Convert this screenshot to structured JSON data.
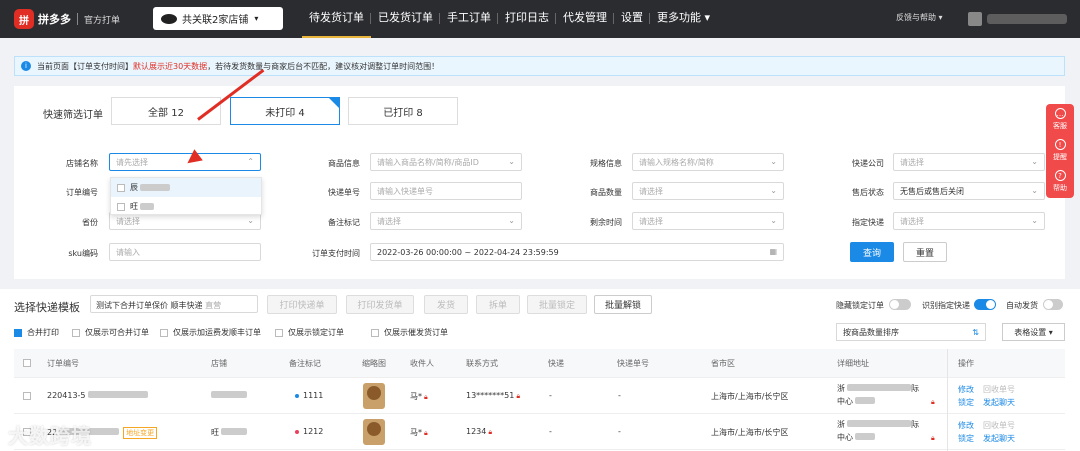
{
  "topbar": {
    "logo_badge": "拼",
    "logo_name": "拼多多",
    "logo_sub": "官方打单",
    "shop_select": "共关联2家店铺",
    "navs": [
      "待发货订单",
      "已发货订单",
      "手工订单",
      "打印日志",
      "代发管理",
      "设置",
      "更多功能 ▾"
    ],
    "feedback": "反馈与帮助 ▾"
  },
  "notice": {
    "icon": "info-icon",
    "prefix": "当前页面【订单支付时间】",
    "highlight": "默认展示近30天数据",
    "suffix": "，若待发货数量与商家后台不匹配，建议核对调整订单时间范围！"
  },
  "filter": {
    "quick_label": "快速筛选订单",
    "tabs": [
      {
        "label": "全部  12"
      },
      {
        "label": "未打印  4"
      },
      {
        "label": "已打印  8"
      }
    ],
    "fields": {
      "shop_name": {
        "label": "店铺名称",
        "placeholder": "请先选择"
      },
      "product_info": {
        "label": "商品信息",
        "placeholder": "请输入商品名称/简称/商品ID"
      },
      "spec_info": {
        "label": "规格信息",
        "placeholder": "请输入规格名称/简称"
      },
      "express_co": {
        "label": "快递公司",
        "placeholder": "请选择"
      },
      "order_no": {
        "label": "订单编号",
        "placeholder": ""
      },
      "tracking_no": {
        "label": "快递单号",
        "placeholder": "请输入快递单号"
      },
      "product_qty": {
        "label": "商品数量",
        "placeholder": "请选择"
      },
      "aftersale": {
        "label": "售后状态",
        "value": "无售后或售后关闭"
      },
      "province": {
        "label": "省份",
        "placeholder": "请选择"
      },
      "remark_flag": {
        "label": "备注标记",
        "placeholder": "请选择"
      },
      "remain_time": {
        "label": "剩余时间",
        "placeholder": "请选择"
      },
      "designated_express": {
        "label": "指定快递",
        "placeholder": "请选择"
      },
      "sku_code": {
        "label": "sku编码",
        "placeholder": "请输入"
      },
      "pay_time": {
        "label": "订单支付时间",
        "value": "2022-03-26 00:00:00 ~ 2022-04-24 23:59:59"
      }
    },
    "query_btn": "查询",
    "reset_btn": "重置",
    "dropdown_items": [
      "辰",
      "旺"
    ]
  },
  "section": {
    "title": "选择快递模板",
    "template_value": "测试下合并订单保价 顺丰快递",
    "template_tag": "直营",
    "buttons": [
      "打印快递单",
      "打印发货单",
      "发货",
      "拆单",
      "批量锁定"
    ],
    "unlock_btn": "批量解锁",
    "toggles": [
      {
        "label": "隐藏锁定订单",
        "on": false
      },
      {
        "label": "识别指定快递",
        "on": true
      },
      {
        "label": "自动发货",
        "on": false
      }
    ],
    "options": [
      {
        "label": "合并打印",
        "checked": true
      },
      {
        "label": "仅展示可合并订单",
        "checked": false
      },
      {
        "label": "仅展示加运费发顺丰订单",
        "checked": false
      },
      {
        "label": "仅展示锁定订单",
        "checked": false
      },
      {
        "label": "仅展示催发货订单",
        "checked": false
      }
    ],
    "sort_select": "按商品数量排序",
    "table_settings": "表格设置 ▾"
  },
  "table": {
    "headers": [
      "订单编号",
      "店铺",
      "备注标记",
      "缩略图",
      "收件人",
      "联系方式",
      "快递",
      "快递单号",
      "省市区",
      "详细地址",
      "操作"
    ],
    "rows": [
      {
        "order_no": "220413-5",
        "tag": "",
        "shop": "",
        "remark": "1111",
        "remark_color": "#1b8ae6",
        "recipient": "马*",
        "phone": "13*******51",
        "express": "-",
        "tracking": "-",
        "region": "上海市/上海市/长宁区",
        "address_line1": "浙",
        "address_line2": "中心",
        "addr_suffix": "际",
        "ops": [
          "修改",
          "回收单号",
          "锁定",
          "发起聊天"
        ]
      },
      {
        "order_no": "22",
        "tag": "地址变更",
        "shop": "旺",
        "remark": "1212",
        "remark_color": "#e8425b",
        "recipient": "马*",
        "phone": "1234",
        "express": "-",
        "tracking": "-",
        "region": "上海市/上海市/长宁区",
        "address_line1": "浙",
        "address_line2": "中心",
        "addr_suffix": "际",
        "ops": [
          "修改",
          "回收单号",
          "锁定",
          "发起聊天"
        ]
      }
    ]
  },
  "side_float": [
    {
      "icon": "chat-icon",
      "label": "客服"
    },
    {
      "icon": "bell-icon",
      "label": "提醒"
    },
    {
      "icon": "help-icon",
      "label": "帮助"
    }
  ],
  "watermark": "大数跨境"
}
